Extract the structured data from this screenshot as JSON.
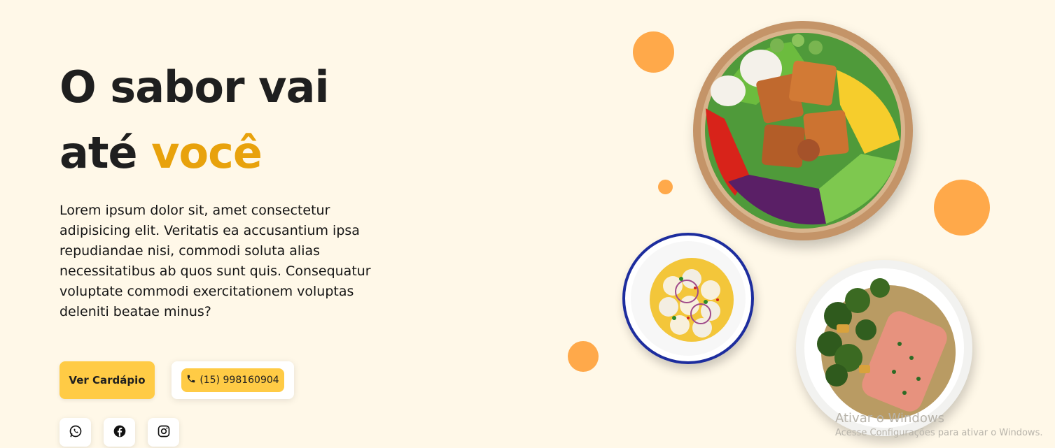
{
  "hero": {
    "title_line1": "O sabor vai",
    "title_line2_prefix": "até ",
    "title_line2_accent": "você",
    "description": "Lorem ipsum dolor sit, amet consectetur adipisicing elit. Veritatis ea accusantium ipsa repudiandae nisi, commodi soluta alias necessitatibus ab quos sunt quis. Consequatur voluptate commodi exercitationem voluptas deleniti beatae minus?",
    "menu_button_label": "Ver Cardápio",
    "phone_number": "(15) 998160904"
  },
  "social": [
    {
      "icon": "whatsapp-icon"
    },
    {
      "icon": "facebook-icon"
    },
    {
      "icon": "instagram-icon"
    }
  ],
  "images": {
    "bowl_salad": "salad-bowl-image",
    "ceviche": "ceviche-bowl-image",
    "salmon": "salmon-plate-image"
  },
  "watermark": {
    "title": "Ativar o Windows",
    "subtitle": "Acesse Configurações para ativar o Windows."
  },
  "colors": {
    "background": "#fff8e8",
    "accent_text": "#e8a20c",
    "button_yellow": "#ffcb45",
    "decor_orange": "#ffa94a",
    "heading": "#1f1f1f"
  }
}
